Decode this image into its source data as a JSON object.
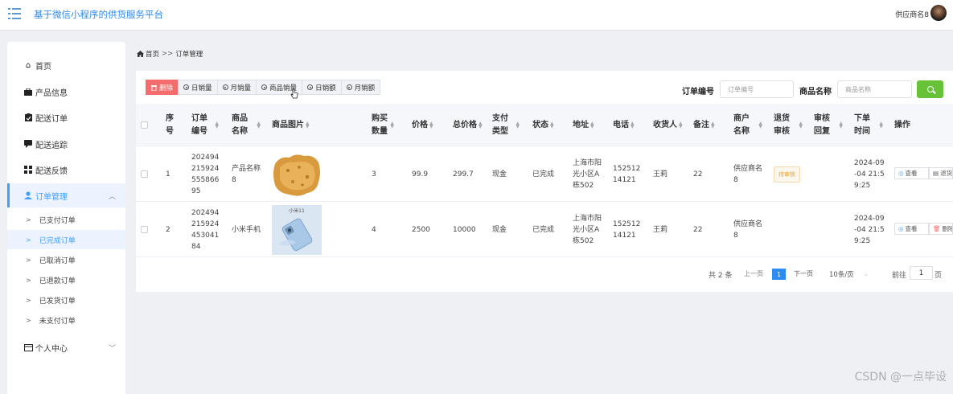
{
  "header": {
    "title": "基于微信小程序的供货服务平台",
    "user": "供应商名8"
  },
  "sidebar": {
    "items": [
      {
        "label": "首页",
        "icon": "home-icon"
      },
      {
        "label": "产品信息",
        "icon": "briefcase-icon"
      },
      {
        "label": "配送订单",
        "icon": "clipboard-icon"
      },
      {
        "label": "配送追踪",
        "icon": "message-icon"
      },
      {
        "label": "配送反馈",
        "icon": "grid-icon"
      },
      {
        "label": "订单管理",
        "icon": "user-icon"
      },
      {
        "label": "个人中心",
        "icon": "id-card-icon"
      }
    ],
    "sub_items": [
      "已支付订单",
      "已完成订单",
      "已取消订单",
      "已退款订单",
      "已发货订单",
      "未支付订单"
    ]
  },
  "breadcrumb": {
    "home": "首页",
    "sep": ">>",
    "current": "订单管理"
  },
  "toolbar": {
    "delete_label": "删除",
    "stats": [
      "日销量",
      "月销量",
      "商品销量",
      "日销额",
      "月销额"
    ]
  },
  "search": {
    "order_label": "订单编号",
    "order_placeholder": "订单编号",
    "product_label": "商品名称",
    "product_placeholder": "商品名称"
  },
  "table": {
    "headers": {
      "index": "序号",
      "order_no": "订单编号",
      "product_name": "商品名称",
      "image": "商品图片",
      "qty": "购买数量",
      "price": "价格",
      "total": "总价格",
      "pay_type": "支付类型",
      "status": "状态",
      "address": "地址",
      "phone": "电话",
      "receiver": "收货人",
      "note": "备注",
      "merchant": "商户名称",
      "refund_review": "退货审核",
      "review_reply": "审核回复",
      "time": "下单时间",
      "ops": "操作"
    },
    "rows": [
      {
        "index": "1",
        "order_no": "20249421592455586695",
        "product_name": "产品名称8",
        "qty": "3",
        "price": "99.9",
        "total": "299.7",
        "pay_type": "现金",
        "status": "已完成",
        "address": "上海市阳光小区A栋502",
        "phone": "15251214121",
        "receiver": "王莉",
        "note": "22",
        "merchant": "供应商名8",
        "refund_review": "待审核",
        "review_reply": "",
        "time": "2024-09-04 21:59:25",
        "view": "查看",
        "second_op": "退货"
      },
      {
        "index": "2",
        "order_no": "20249421592445304184",
        "product_name": "小米手机",
        "qty": "4",
        "price": "2500",
        "total": "10000",
        "pay_type": "现金",
        "status": "已完成",
        "address": "上海市阳光小区A栋502",
        "phone": "15251214121",
        "receiver": "王莉",
        "note": "22",
        "merchant": "供应商名8",
        "refund_review": "",
        "review_reply": "",
        "time": "2024-09-04 21:59:25",
        "view": "查看",
        "second_op": "删除"
      }
    ],
    "image_caption_2": "小米11"
  },
  "pagination": {
    "total": "共 2 条",
    "prev": "上一页",
    "page": "1",
    "next": "下一页",
    "size": "10条/页",
    "goto": "前往",
    "goto_value": "1",
    "page_unit": "页"
  },
  "watermark": "CSDN @一点毕设"
}
